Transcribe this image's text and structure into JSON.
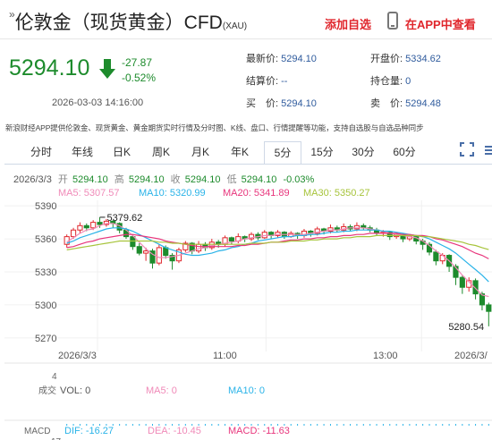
{
  "header": {
    "title": "伦敦金（现货黄金）CFD",
    "code": "(XAU)",
    "add_favorite": "添加自选",
    "app_link": "在APP中查看"
  },
  "price": {
    "last": "5294.10",
    "change": "-27.87",
    "change_pct": "-0.52%",
    "timestamp": "2026-03-03 14:16:00"
  },
  "quote": {
    "latest_label": "最新价:",
    "latest_value": "5294.10",
    "open_label": "开盘价:",
    "open_value": "5334.62",
    "settle_label": "结算价:",
    "settle_value": "--",
    "position_label": "持仓量:",
    "position_value": "0",
    "bid_label": "买　价:",
    "bid_value": "5294.10",
    "ask_label": "卖　价:",
    "ask_value": "5294.48"
  },
  "description": "新浪财经APP提供伦敦金、现货黄金、黄金期货实时行情及分时图、K线、盘口、行情提醒等功能，支持自选股与自选品种同步",
  "tabs": [
    "分时",
    "年线",
    "日K",
    "周K",
    "月K",
    "年K",
    "5分",
    "15分",
    "30分",
    "60分"
  ],
  "active_tab": "5分",
  "chart_info": {
    "date": "2026/3/3",
    "open_label": "开",
    "open": "5294.10",
    "high_label": "高",
    "high": "5294.10",
    "close_label": "收",
    "close": "5294.10",
    "low_label": "低",
    "low": "5294.10",
    "pct": "-0.03%",
    "ma5": "MA5: 5307.57",
    "ma10": "MA10: 5320.99",
    "ma20": "MA20: 5341.89",
    "ma30": "MA30: 5350.27",
    "vol_title": "成交",
    "vol_unit": "4",
    "vol": "VOL: 0",
    "vol_ma5": "MA5: 0",
    "vol_ma10": "MA10: 0",
    "macd_title": "MACD",
    "macd_unit": "17",
    "dif": "DIF: -16.27",
    "dea": "DEA: -10.45",
    "macd": "MACD: -11.63"
  },
  "colors": {
    "up": "#e0272d",
    "down": "#1d8b2c",
    "ma5": "#f08ab8",
    "ma10": "#2ab3e8",
    "ma20": "#e8357c",
    "ma30": "#a7c43b",
    "blue_text": "#2f5b9d"
  },
  "chart_data": {
    "type": "candlestick",
    "y_ticks": [
      5390,
      5360,
      5330,
      5300,
      5270
    ],
    "ylim": [
      5265,
      5395
    ],
    "x_ticks": [
      "2026/3/3",
      "11:00",
      "13:00",
      "2026/3/"
    ],
    "high_label": "5379.62",
    "low_label": "5280.54",
    "candles": [
      [
        5355,
        5362,
        5352,
        5364
      ],
      [
        5362,
        5368,
        5360,
        5370
      ],
      [
        5368,
        5372,
        5365,
        5375
      ],
      [
        5372,
        5370,
        5367,
        5374
      ],
      [
        5370,
        5375,
        5368,
        5377
      ],
      [
        5375,
        5373,
        5370,
        5379.62
      ],
      [
        5373,
        5376,
        5371,
        5378
      ],
      [
        5376,
        5374,
        5370,
        5377
      ],
      [
        5374,
        5368,
        5365,
        5375
      ],
      [
        5368,
        5362,
        5360,
        5370
      ],
      [
        5362,
        5353,
        5350,
        5364
      ],
      [
        5353,
        5347,
        5345,
        5356
      ],
      [
        5347,
        5349,
        5340,
        5352
      ],
      [
        5349,
        5338,
        5333,
        5351
      ],
      [
        5338,
        5352,
        5336,
        5355
      ],
      [
        5352,
        5345,
        5342,
        5354
      ],
      [
        5345,
        5340,
        5332,
        5347
      ],
      [
        5340,
        5350,
        5338,
        5352
      ],
      [
        5350,
        5356,
        5348,
        5358
      ],
      [
        5356,
        5349,
        5346,
        5357
      ],
      [
        5349,
        5355,
        5347,
        5358
      ],
      [
        5355,
        5352,
        5349,
        5357
      ],
      [
        5352,
        5357,
        5350,
        5360
      ],
      [
        5357,
        5355,
        5352,
        5359
      ],
      [
        5355,
        5361,
        5353,
        5363
      ],
      [
        5361,
        5358,
        5355,
        5362
      ],
      [
        5358,
        5362,
        5356,
        5365
      ],
      [
        5362,
        5360,
        5357,
        5363
      ],
      [
        5360,
        5364,
        5358,
        5366
      ],
      [
        5364,
        5361,
        5359,
        5366
      ],
      [
        5361,
        5366,
        5360,
        5368
      ],
      [
        5366,
        5363,
        5360,
        5367
      ],
      [
        5363,
        5366,
        5361,
        5368
      ],
      [
        5366,
        5362,
        5360,
        5367
      ],
      [
        5362,
        5365,
        5361,
        5367
      ],
      [
        5365,
        5363,
        5360,
        5366
      ],
      [
        5363,
        5367,
        5361,
        5369
      ],
      [
        5367,
        5365,
        5362,
        5368
      ],
      [
        5365,
        5369,
        5363,
        5371
      ],
      [
        5369,
        5367,
        5364,
        5370
      ],
      [
        5367,
        5370,
        5365,
        5373
      ],
      [
        5370,
        5368,
        5366,
        5372
      ],
      [
        5368,
        5371,
        5366,
        5374
      ],
      [
        5371,
        5369,
        5367,
        5373
      ],
      [
        5369,
        5372,
        5367,
        5375
      ],
      [
        5372,
        5370,
        5368,
        5374
      ],
      [
        5370,
        5368,
        5366,
        5372
      ],
      [
        5368,
        5365,
        5363,
        5370
      ],
      [
        5365,
        5366,
        5362,
        5368
      ],
      [
        5366,
        5362,
        5359,
        5367
      ],
      [
        5362,
        5364,
        5360,
        5366
      ],
      [
        5364,
        5360,
        5357,
        5365
      ],
      [
        5360,
        5362,
        5358,
        5364
      ],
      [
        5362,
        5358,
        5355,
        5363
      ],
      [
        5358,
        5355,
        5350,
        5360
      ],
      [
        5355,
        5348,
        5345,
        5357
      ],
      [
        5348,
        5340,
        5336,
        5350
      ],
      [
        5340,
        5345,
        5337,
        5347
      ],
      [
        5345,
        5335,
        5330,
        5346
      ],
      [
        5335,
        5325,
        5318,
        5337
      ],
      [
        5325,
        5316,
        5310,
        5327
      ],
      [
        5316,
        5322,
        5312,
        5325
      ],
      [
        5322,
        5310,
        5305,
        5324
      ],
      [
        5310,
        5300,
        5295,
        5312
      ],
      [
        5300,
        5294.1,
        5280.54,
        5302
      ]
    ],
    "ma": {
      "ma5": [
        5357,
        5361,
        5365,
        5368,
        5369,
        5372,
        5374,
        5374,
        5372,
        5368,
        5363,
        5357,
        5351,
        5346,
        5343,
        5343,
        5344,
        5345,
        5347,
        5349,
        5351,
        5352,
        5354,
        5355,
        5356,
        5357,
        5358,
        5360,
        5361,
        5362,
        5363,
        5363,
        5364,
        5364,
        5364,
        5364,
        5364,
        5365,
        5366,
        5367,
        5368,
        5368,
        5369,
        5370,
        5370,
        5370,
        5369,
        5368,
        5367,
        5365,
        5364,
        5363,
        5362,
        5361,
        5358,
        5354,
        5349,
        5345,
        5340,
        5334,
        5327,
        5321,
        5315,
        5309,
        5307.57
      ],
      "ma10": [
        5356,
        5358,
        5361,
        5363,
        5365,
        5367,
        5369,
        5370,
        5370,
        5369,
        5367,
        5364,
        5361,
        5358,
        5355,
        5352,
        5350,
        5348,
        5346,
        5345,
        5345,
        5346,
        5347,
        5349,
        5350,
        5352,
        5353,
        5355,
        5356,
        5358,
        5359,
        5360,
        5361,
        5362,
        5362,
        5363,
        5363,
        5364,
        5364,
        5365,
        5366,
        5366,
        5367,
        5367,
        5368,
        5368,
        5368,
        5368,
        5367,
        5367,
        5366,
        5365,
        5364,
        5363,
        5362,
        5360,
        5357,
        5354,
        5351,
        5347,
        5342,
        5337,
        5332,
        5327,
        5320.99
      ],
      "ma20": [
        5352,
        5353,
        5355,
        5357,
        5358,
        5360,
        5361,
        5362,
        5363,
        5364,
        5364,
        5363,
        5362,
        5361,
        5360,
        5358,
        5357,
        5356,
        5355,
        5354,
        5353,
        5353,
        5353,
        5353,
        5353,
        5353,
        5354,
        5354,
        5355,
        5355,
        5356,
        5357,
        5357,
        5358,
        5359,
        5359,
        5360,
        5360,
        5361,
        5361,
        5362,
        5362,
        5363,
        5363,
        5364,
        5364,
        5365,
        5365,
        5365,
        5365,
        5365,
        5364,
        5364,
        5363,
        5363,
        5362,
        5360,
        5359,
        5357,
        5355,
        5353,
        5350,
        5347,
        5345,
        5341.89
      ],
      "ma30": [
        5350,
        5351,
        5352,
        5353,
        5354,
        5355,
        5356,
        5357,
        5358,
        5358,
        5358,
        5358,
        5358,
        5358,
        5357,
        5357,
        5356,
        5356,
        5355,
        5355,
        5355,
        5355,
        5355,
        5355,
        5355,
        5355,
        5355,
        5355,
        5356,
        5356,
        5356,
        5357,
        5357,
        5357,
        5358,
        5358,
        5358,
        5359,
        5359,
        5360,
        5360,
        5360,
        5361,
        5361,
        5362,
        5362,
        5362,
        5363,
        5363,
        5363,
        5363,
        5363,
        5363,
        5363,
        5362,
        5362,
        5361,
        5360,
        5359,
        5358,
        5357,
        5355,
        5354,
        5352,
        5350.27
      ]
    },
    "macd_hist": [
      -1,
      -1,
      -1,
      -1,
      -1,
      -1,
      -1,
      -1,
      -1,
      -1,
      -1,
      -1,
      -1,
      -1,
      -1,
      -1,
      -1,
      -1,
      -1,
      -1,
      -1,
      -1,
      -1,
      -1,
      -1,
      -1,
      -1,
      -1,
      -1,
      -1,
      -1,
      -1,
      -1,
      -1,
      -1,
      -1,
      -1,
      -1,
      -1,
      -1,
      -1,
      -1,
      -1,
      -1,
      -1,
      -1,
      -1,
      -1,
      -1,
      -1,
      -1,
      -1,
      -1,
      -1,
      -1,
      -1,
      -1,
      -1,
      -1,
      -1,
      -1,
      -1,
      -1,
      -1,
      -1
    ]
  }
}
